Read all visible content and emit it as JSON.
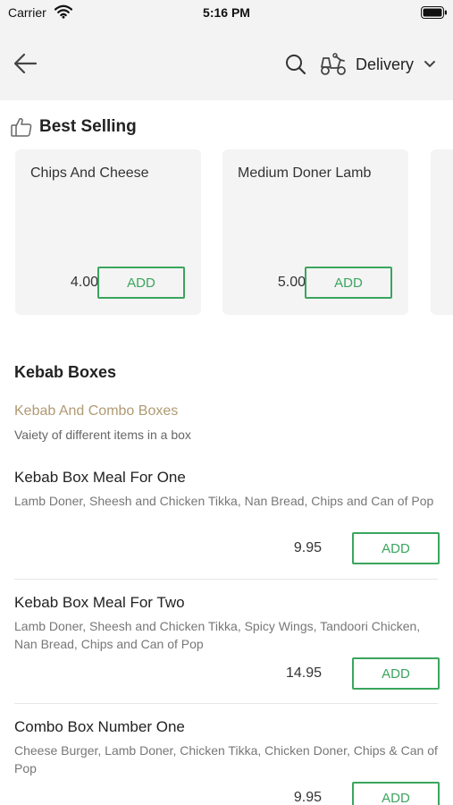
{
  "status_bar": {
    "carrier": "Carrier",
    "time": "5:16 PM"
  },
  "nav": {
    "delivery_label": "Delivery"
  },
  "best_selling": {
    "title": "Best Selling",
    "items": [
      {
        "name": "Chips And Cheese",
        "price": "4.00",
        "add_label": "ADD"
      },
      {
        "name": "Medium Doner Lamb",
        "price": "5.00",
        "add_label": "ADD"
      }
    ]
  },
  "section": {
    "title": "Kebab Boxes",
    "category_title": "Kebab And Combo Boxes",
    "category_desc": "Vaiety of different items in a box",
    "items": [
      {
        "name": "Kebab Box Meal For One",
        "desc": "Lamb Doner, Sheesh and Chicken Tikka, Nan Bread, Chips and Can of Pop",
        "price": "9.95",
        "add_label": "ADD"
      },
      {
        "name": "Kebab Box Meal For Two",
        "desc": "Lamb Doner, Sheesh and Chicken Tikka, Spicy Wings, Tandoori Chicken, Nan Bread, Chips and Can of Pop",
        "price": "14.95",
        "add_label": "ADD"
      },
      {
        "name": "Combo Box Number One",
        "desc": "Cheese Burger, Lamb Doner, Chicken Tikka, Chicken Doner, Chips & Can of Pop",
        "price": "9.95",
        "add_label": "ADD"
      }
    ]
  },
  "colors": {
    "accent_green": "#3aa55e",
    "category_gold": "#b09a73",
    "header_bg": "#f3f3f3"
  }
}
